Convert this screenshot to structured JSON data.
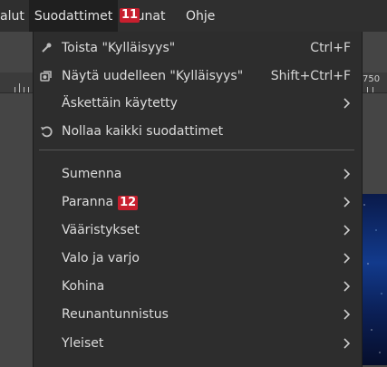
{
  "menubar": {
    "items": [
      "alut",
      "Suodattimet",
      "kunat",
      "Ohje"
    ],
    "badge": "11"
  },
  "ruler": {
    "label": "750"
  },
  "menu": {
    "repeat": {
      "label": "Toista \"Kylläisyys\"",
      "shortcut": "Ctrl+F",
      "icon": "repeat-filter-icon"
    },
    "reshow": {
      "label": "Näytä uudelleen \"Kylläisyys\"",
      "shortcut": "Shift+Ctrl+F",
      "icon": "reshow-filter-icon"
    },
    "recent": {
      "label": "Äskettäin käytetty"
    },
    "reset": {
      "label": "Nollaa kaikki suodattimet",
      "icon": "reset-icon"
    },
    "submenus": [
      {
        "label": "Sumenna"
      },
      {
        "label": "Paranna",
        "badge": "12"
      },
      {
        "label": "Vääristykset"
      },
      {
        "label": "Valo ja varjo"
      },
      {
        "label": "Kohina"
      },
      {
        "label": "Reunantunnistus"
      },
      {
        "label": "Yleiset"
      }
    ]
  },
  "colors": {
    "badge": "#c81f2e",
    "menu_bg": "#2d2d2d",
    "menubar_bg": "#2f2f2f"
  }
}
